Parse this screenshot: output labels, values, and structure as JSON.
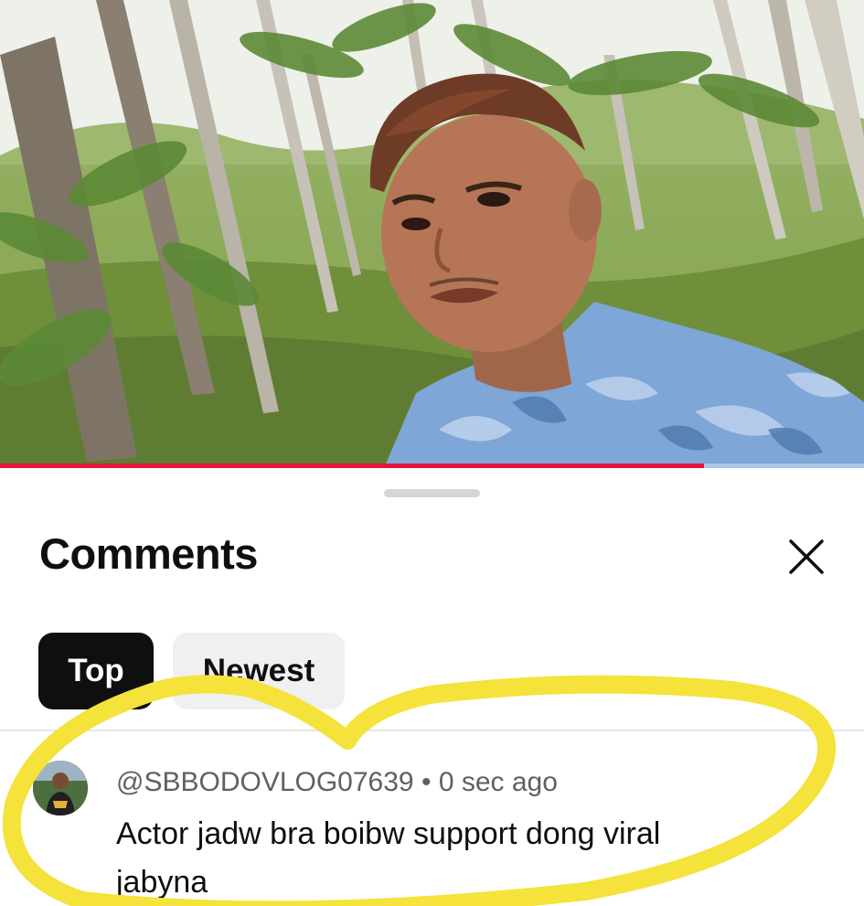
{
  "video": {
    "progress_fraction": 0.815,
    "progress_color": "#e3163c"
  },
  "comments_sheet": {
    "title": "Comments",
    "close_icon": "close-icon",
    "sort_chips": [
      {
        "label": "Top",
        "selected": true
      },
      {
        "label": "Newest",
        "selected": false
      }
    ],
    "comments": [
      {
        "author": "@SBBODOVLOG07639",
        "separator": "•",
        "time": "0 sec ago",
        "text": "Actor jadw  bra boibw support dong viral jabyna"
      }
    ]
  },
  "annotation": {
    "color": "#f5e23a"
  }
}
